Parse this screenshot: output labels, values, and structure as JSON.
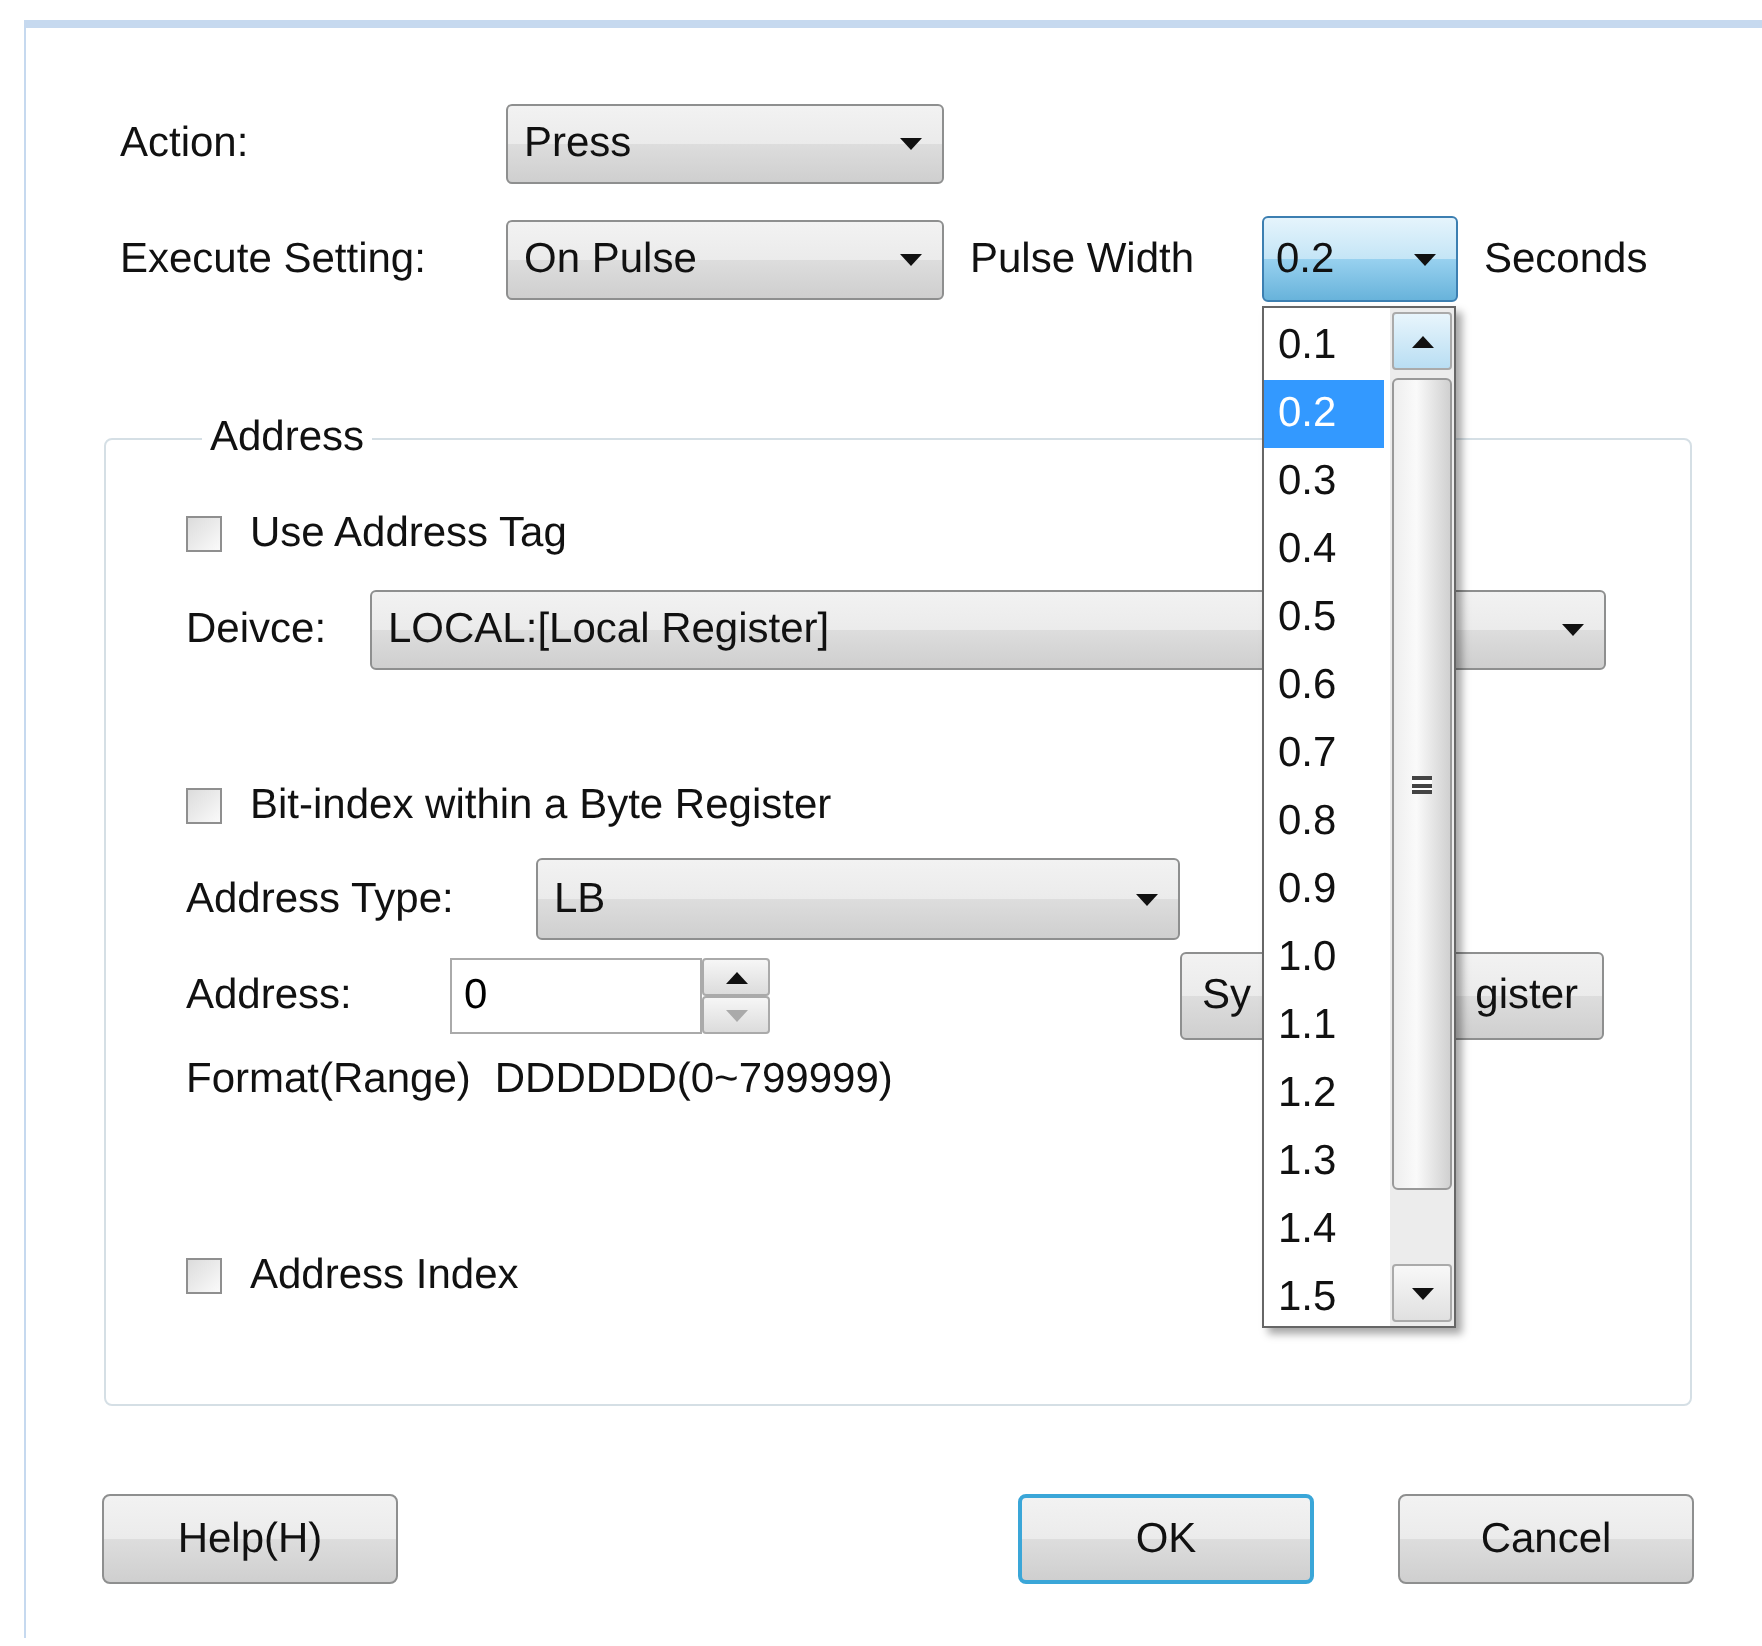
{
  "action": {
    "label": "Action:",
    "value": "Press"
  },
  "execute_setting": {
    "label": "Execute Setting:",
    "value": "On Pulse"
  },
  "pulse_width": {
    "label": "Pulse Width",
    "value": "0.2",
    "unit": "Seconds",
    "expanded": true,
    "options": [
      {
        "label": "0.1",
        "selected": false
      },
      {
        "label": "0.2",
        "selected": true
      },
      {
        "label": "0.3",
        "selected": false
      },
      {
        "label": "0.4",
        "selected": false
      },
      {
        "label": "0.5",
        "selected": false
      },
      {
        "label": "0.6",
        "selected": false
      },
      {
        "label": "0.7",
        "selected": false
      },
      {
        "label": "0.8",
        "selected": false
      },
      {
        "label": "0.9",
        "selected": false
      },
      {
        "label": "1.0",
        "selected": false
      },
      {
        "label": "1.1",
        "selected": false
      },
      {
        "label": "1.2",
        "selected": false
      },
      {
        "label": "1.3",
        "selected": false
      },
      {
        "label": "1.4",
        "selected": false
      },
      {
        "label": "1.5",
        "selected": false
      }
    ]
  },
  "address_group": {
    "title": "Address",
    "use_address_tag": {
      "label": "Use Address Tag",
      "checked": false
    },
    "device": {
      "label": "Deivce:",
      "value": "LOCAL:[Local Register]"
    },
    "bit_index": {
      "label": "Bit-index within a Byte Register",
      "checked": false
    },
    "address_type": {
      "label": "Address Type:",
      "value": "LB"
    },
    "address": {
      "label": "Address:",
      "value": "0"
    },
    "system_register_button": {
      "visible_parts": [
        "Sy",
        "gister"
      ]
    },
    "format": {
      "label": "Format(Range)",
      "value": "DDDDDD(0~799999)"
    },
    "address_index": {
      "label": "Address Index",
      "checked": false
    }
  },
  "buttons": [
    {
      "label": "Help(H)",
      "default": false
    },
    {
      "label": "OK",
      "default": true
    },
    {
      "label": "Cancel",
      "default": false
    }
  ]
}
